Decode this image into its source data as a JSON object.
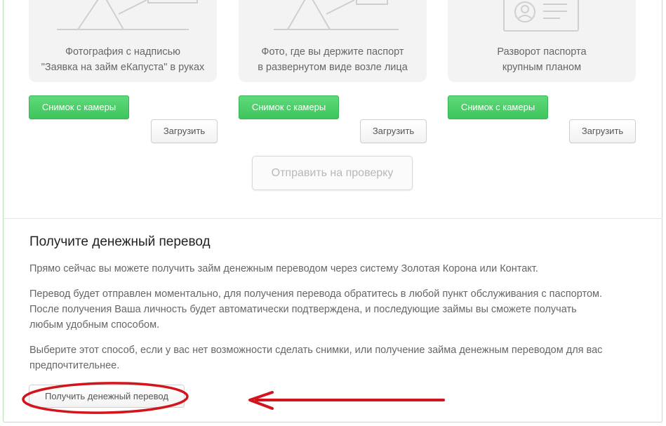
{
  "cards": [
    {
      "caption_line1": "Фотография с надписью",
      "caption_line2": "\"Заявка на займ еКапуста\" в руках",
      "camera_label": "Снимок с камеры",
      "upload_label": "Загрузить"
    },
    {
      "caption_line1": "Фото, где вы держите паспорт",
      "caption_line2": "в развернутом виде возле лица",
      "camera_label": "Снимок с камеры",
      "upload_label": "Загрузить"
    },
    {
      "caption_line1": "Разворот паспорта",
      "caption_line2": "крупным планом",
      "camera_label": "Снимок с камеры",
      "upload_label": "Загрузить"
    }
  ],
  "submit_label": "Отправить на проверку",
  "transfer": {
    "title": "Получите денежный перевод",
    "p1": "Прямо сейчас вы можете получить займ денежным переводом через систему Золотая Корона или Контакт.",
    "p2_line1": "Перевод будет отправлен моментально, для получения перевода обратитесь в любой пункт обслуживания с паспортом.",
    "p2_line2": "После получения Ваша личность будет автоматически подтверждена, и последующие займы вы сможете получать",
    "p2_line3": "любым удобным способом.",
    "p3_line1": "Выберите этот способ, если у вас нет возможности сделать снимки, или получение займа денежным переводом для вас",
    "p3_line2": "предпочтительнее.",
    "button_label": "Получить денежный перевод"
  },
  "colors": {
    "green_button": "#45c961",
    "annotation_red": "#d4141c",
    "frame_border": "#b9e2b9"
  },
  "icons": [
    "person-with-sign-illustration",
    "person-with-passport-illustration",
    "passport-id-card-icon",
    "red-arrow-annotation",
    "red-ellipse-annotation"
  ]
}
